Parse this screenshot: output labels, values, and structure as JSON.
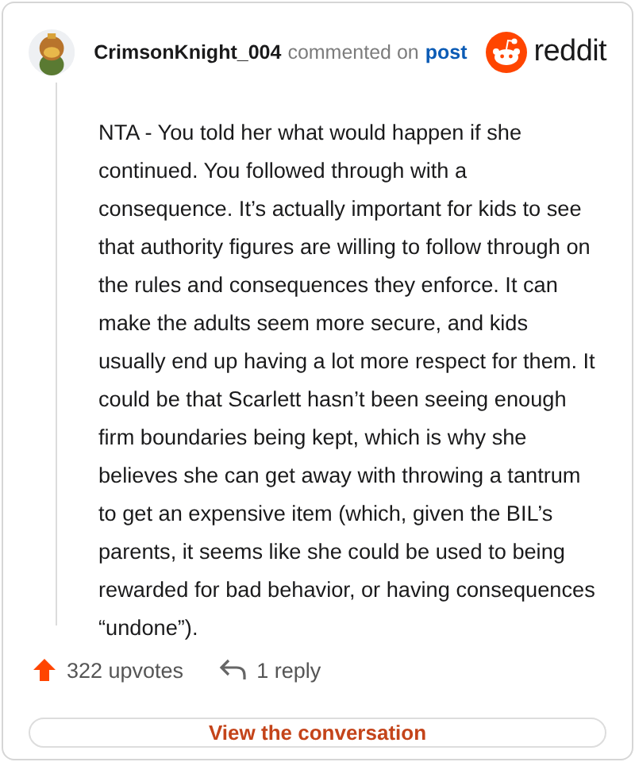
{
  "header": {
    "author": "CrimsonKnight_004",
    "action": "commented on",
    "link": "post",
    "brand": "reddit"
  },
  "comment": {
    "body": "NTA - You told her what would happen if she continued. You followed through with a consequence. It’s actually important for kids to see that authority figures are willing to follow through on the rules and consequences they enforce. It can make the adults seem more secure, and kids usually end up having a lot more respect for them. It could be that Scarlett hasn’t been seeing enough firm boundaries being kept, which is why she believes she can get away with throwing a tantrum to get an expensive item (which, given the BIL’s parents, it seems like she could be used to being rewarded for bad behavior, or having consequences “undone”)."
  },
  "stats": {
    "upvotes": "322 upvotes",
    "replies": "1 reply"
  },
  "button": {
    "label": "View the conversation"
  }
}
